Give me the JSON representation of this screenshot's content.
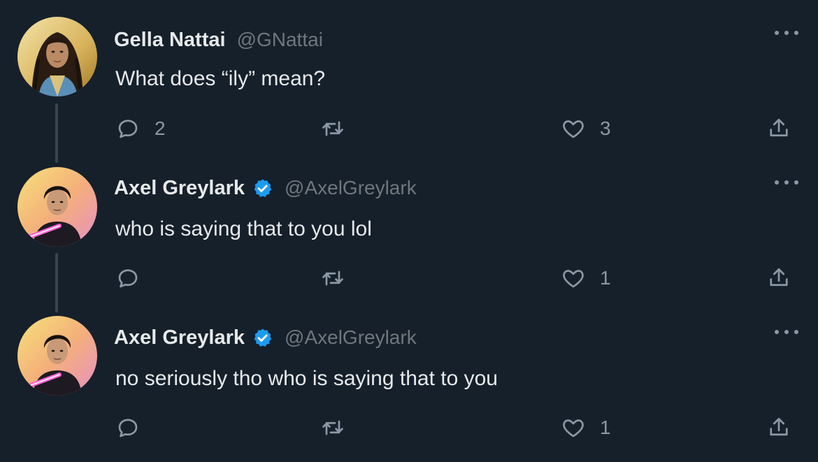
{
  "tweets": [
    {
      "display_name": "Gella Nattai",
      "handle": "@GNattai",
      "verified": false,
      "text": "What does “ily” mean?",
      "reply_count": "2",
      "retweet_count": "",
      "like_count": "3",
      "avatar": "gella-avatar"
    },
    {
      "display_name": "Axel Greylark",
      "handle": "@AxelGreylark",
      "verified": true,
      "text": "who is saying that to you lol",
      "reply_count": "",
      "retweet_count": "",
      "like_count": "1",
      "avatar": "axel-avatar"
    },
    {
      "display_name": "Axel Greylark",
      "handle": "@AxelGreylark",
      "verified": true,
      "text": "no seriously tho who is saying that to you",
      "reply_count": "",
      "retweet_count": "",
      "like_count": "1",
      "avatar": "axel-avatar"
    }
  ],
  "icons": {
    "reply": "reply-bubble-icon",
    "retweet": "retweet-icon",
    "like": "heart-icon",
    "share": "share-icon",
    "more": "more-dots-icon",
    "verified": "verified-badge-icon"
  },
  "colors": {
    "background": "#15202b",
    "primary_text": "#e7e9ea",
    "secondary_text": "#71767b",
    "icon": "#8b98a5",
    "verified": "#1d9bf0",
    "thread_line": "#3a444c"
  }
}
